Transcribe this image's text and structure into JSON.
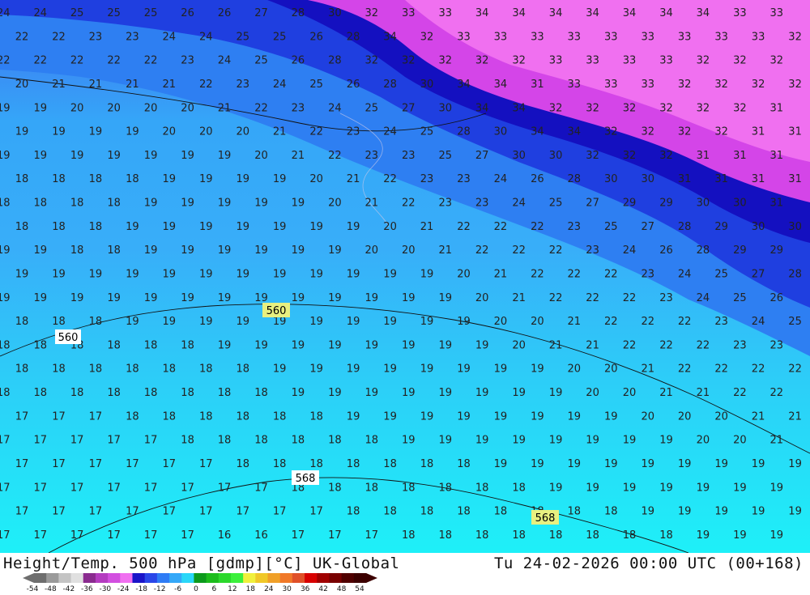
{
  "map": {
    "contour_labels": [
      "560",
      "560",
      "568",
      "568"
    ],
    "field_grid": [
      [
        "24",
        "24",
        "25",
        "25",
        "25",
        "26",
        "26",
        "27",
        "28",
        "30",
        "32",
        "33",
        "33",
        "34",
        "34",
        "34",
        "34",
        "34",
        "34",
        "34",
        "33",
        "33"
      ],
      [
        "22",
        "22",
        "23",
        "23",
        "24",
        "24",
        "25",
        "25",
        "26",
        "28",
        "34",
        "32",
        "33",
        "33",
        "33",
        "33",
        "33",
        "33",
        "33",
        "33",
        "33",
        "32"
      ],
      [
        "22",
        "22",
        "22",
        "22",
        "22",
        "23",
        "24",
        "25",
        "26",
        "28",
        "32",
        "32",
        "32",
        "32",
        "32",
        "33",
        "33",
        "33",
        "33",
        "32",
        "32",
        "32"
      ],
      [
        "20",
        "21",
        "21",
        "21",
        "21",
        "22",
        "23",
        "24",
        "25",
        "26",
        "28",
        "30",
        "34",
        "34",
        "31",
        "33",
        "33",
        "33",
        "32",
        "32",
        "32",
        "32"
      ],
      [
        "19",
        "19",
        "20",
        "20",
        "20",
        "20",
        "21",
        "22",
        "23",
        "24",
        "25",
        "27",
        "30",
        "34",
        "34",
        "32",
        "32",
        "32",
        "32",
        "32",
        "32",
        "31"
      ],
      [
        "19",
        "19",
        "19",
        "19",
        "20",
        "20",
        "20",
        "21",
        "22",
        "23",
        "24",
        "25",
        "28",
        "30",
        "34",
        "34",
        "32",
        "32",
        "32",
        "32",
        "31",
        "31"
      ],
      [
        "19",
        "19",
        "19",
        "19",
        "19",
        "19",
        "19",
        "20",
        "21",
        "22",
        "23",
        "23",
        "25",
        "27",
        "30",
        "30",
        "32",
        "32",
        "32",
        "31",
        "31",
        "31"
      ],
      [
        "18",
        "18",
        "18",
        "18",
        "19",
        "19",
        "19",
        "19",
        "20",
        "21",
        "22",
        "23",
        "23",
        "24",
        "26",
        "28",
        "30",
        "30",
        "31",
        "31",
        "31",
        "31"
      ],
      [
        "18",
        "18",
        "18",
        "18",
        "19",
        "19",
        "19",
        "19",
        "19",
        "20",
        "21",
        "22",
        "23",
        "23",
        "24",
        "25",
        "27",
        "29",
        "29",
        "30",
        "30",
        "31"
      ],
      [
        "18",
        "18",
        "18",
        "19",
        "19",
        "19",
        "19",
        "19",
        "19",
        "19",
        "20",
        "21",
        "22",
        "22",
        "22",
        "23",
        "25",
        "27",
        "28",
        "29",
        "30",
        "30"
      ],
      [
        "19",
        "19",
        "18",
        "18",
        "19",
        "19",
        "19",
        "19",
        "19",
        "19",
        "20",
        "20",
        "21",
        "22",
        "22",
        "22",
        "23",
        "24",
        "26",
        "28",
        "29",
        "29"
      ],
      [
        "19",
        "19",
        "19",
        "19",
        "19",
        "19",
        "19",
        "19",
        "19",
        "19",
        "19",
        "19",
        "20",
        "21",
        "22",
        "22",
        "22",
        "23",
        "24",
        "25",
        "27",
        "28"
      ],
      [
        "19",
        "19",
        "19",
        "19",
        "19",
        "19",
        "19",
        "19",
        "19",
        "19",
        "19",
        "19",
        "19",
        "20",
        "21",
        "22",
        "22",
        "22",
        "23",
        "24",
        "25",
        "26"
      ],
      [
        "18",
        "18",
        "18",
        "19",
        "19",
        "19",
        "19",
        "19",
        "19",
        "19",
        "19",
        "19",
        "19",
        "20",
        "20",
        "21",
        "22",
        "22",
        "22",
        "23",
        "24",
        "25"
      ],
      [
        "18",
        "18",
        "18",
        "18",
        "18",
        "18",
        "19",
        "19",
        "19",
        "19",
        "19",
        "19",
        "19",
        "19",
        "20",
        "21",
        "21",
        "22",
        "22",
        "22",
        "23",
        "23"
      ],
      [
        "18",
        "18",
        "18",
        "18",
        "18",
        "18",
        "18",
        "19",
        "19",
        "19",
        "19",
        "19",
        "19",
        "19",
        "19",
        "20",
        "20",
        "21",
        "22",
        "22",
        "22",
        "22"
      ],
      [
        "18",
        "18",
        "18",
        "18",
        "18",
        "18",
        "18",
        "18",
        "19",
        "19",
        "19",
        "19",
        "19",
        "19",
        "19",
        "19",
        "20",
        "20",
        "21",
        "21",
        "22",
        "22"
      ],
      [
        "17",
        "17",
        "17",
        "18",
        "18",
        "18",
        "18",
        "18",
        "18",
        "19",
        "19",
        "19",
        "19",
        "19",
        "19",
        "19",
        "19",
        "20",
        "20",
        "20",
        "21",
        "21"
      ],
      [
        "17",
        "17",
        "17",
        "17",
        "17",
        "18",
        "18",
        "18",
        "18",
        "18",
        "18",
        "19",
        "19",
        "19",
        "19",
        "19",
        "19",
        "19",
        "19",
        "20",
        "20",
        "21"
      ],
      [
        "17",
        "17",
        "17",
        "17",
        "17",
        "17",
        "18",
        "18",
        "18",
        "18",
        "18",
        "18",
        "18",
        "19",
        "19",
        "19",
        "19",
        "19",
        "19",
        "19",
        "19",
        "19"
      ],
      [
        "17",
        "17",
        "17",
        "17",
        "17",
        "17",
        "17",
        "17",
        "18",
        "18",
        "18",
        "18",
        "18",
        "18",
        "18",
        "19",
        "19",
        "19",
        "19",
        "19",
        "19",
        "19"
      ],
      [
        "17",
        "17",
        "17",
        "17",
        "17",
        "17",
        "17",
        "17",
        "17",
        "18",
        "18",
        "18",
        "18",
        "18",
        "18",
        "18",
        "18",
        "19",
        "19",
        "19",
        "19",
        "19"
      ],
      [
        "17",
        "17",
        "17",
        "17",
        "17",
        "17",
        "16",
        "16",
        "17",
        "17",
        "17",
        "18",
        "18",
        "18",
        "18",
        "18",
        "18",
        "18",
        "18",
        "19",
        "19",
        "19"
      ]
    ]
  },
  "footer": {
    "title": "Height/Temp. 500 hPa [gdmp][°C] UK-Global",
    "datetime": "Tu 24-02-2026 00:00 UTC (00+168)"
  },
  "colorbar": {
    "ticks": [
      "-54",
      "-48",
      "-42",
      "-36",
      "-30",
      "-24",
      "-18",
      "-12",
      "-6",
      "0",
      "6",
      "12",
      "18",
      "24",
      "30",
      "36",
      "42",
      "48",
      "54"
    ],
    "colors": [
      "#6e6e6e",
      "#9a9a9a",
      "#c4c4c4",
      "#e0e0e0",
      "#8a2b8f",
      "#b43cc0",
      "#d24fe0",
      "#f070f0",
      "#1a14c8",
      "#2a46e8",
      "#2f7cf5",
      "#34a8f8",
      "#2ad7f8",
      "#0c9a1c",
      "#1cbc1c",
      "#2cd82c",
      "#3cf03c",
      "#f0f03c",
      "#f0c828",
      "#f0a028",
      "#f07828",
      "#e05028",
      "#d80000",
      "#a00000",
      "#780000",
      "#500000",
      "#3c0000"
    ]
  }
}
